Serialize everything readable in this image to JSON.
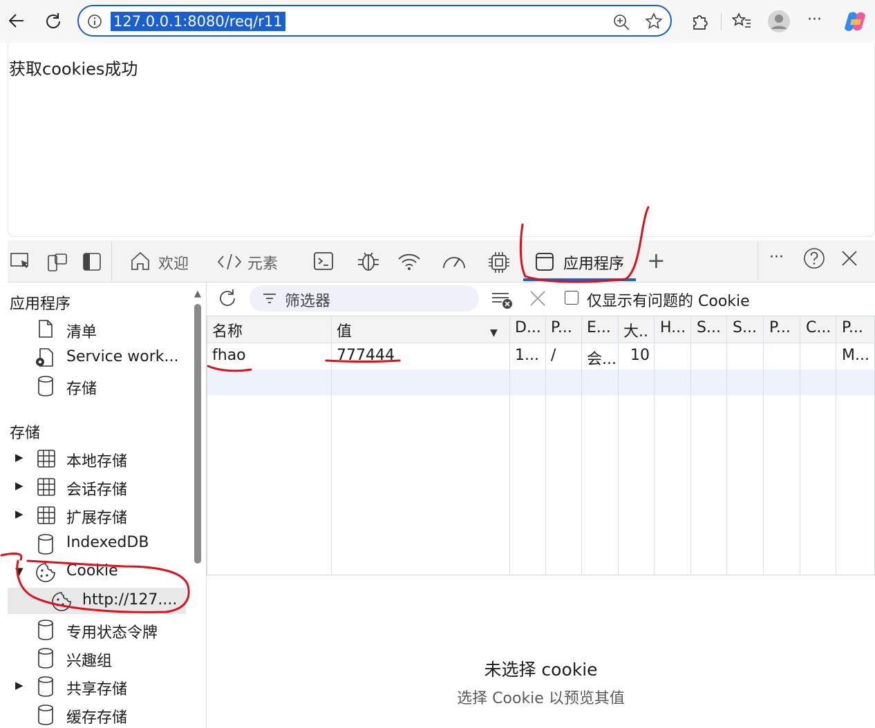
{
  "browser": {
    "url": "127.0.0.1:8080/req/r11",
    "more_label": "···"
  },
  "page": {
    "message": "获取cookies成功"
  },
  "devtools": {
    "tabs": {
      "welcome": "欢迎",
      "elements": "元素",
      "application": "应用程序",
      "add": "+"
    },
    "more_label": "···",
    "sidebar": {
      "app_header": "应用程序",
      "app_items": [
        "清单",
        "Service work...",
        "存储"
      ],
      "storage_header": "存储",
      "storage_items": [
        "本地存储",
        "会话存储",
        "扩展存储",
        "IndexedDB",
        "Cookie",
        "http://127....",
        "专用状态令牌",
        "兴趣组",
        "共享存储",
        "缓存存储"
      ]
    },
    "toolbar": {
      "filter_placeholder": "筛选器",
      "only_issues_label": "仅显示有问题的 Cookie"
    },
    "table": {
      "headers": [
        "名称",
        "值",
        "D...",
        "P...",
        "E...",
        "大..",
        "H...",
        "S...",
        "S...",
        "P...",
        "C...",
        "P..."
      ],
      "rows": [
        [
          "fhao",
          "777444",
          "1...",
          "/",
          "会...",
          "10",
          "",
          "",
          "",
          "",
          "",
          "M..."
        ]
      ]
    },
    "preview": {
      "title": "未选择 cookie",
      "subtitle": "选择 Cookie 以预览其值"
    }
  },
  "colors": {
    "accent": "#1a5fd0",
    "annotation": "#e0101a"
  }
}
